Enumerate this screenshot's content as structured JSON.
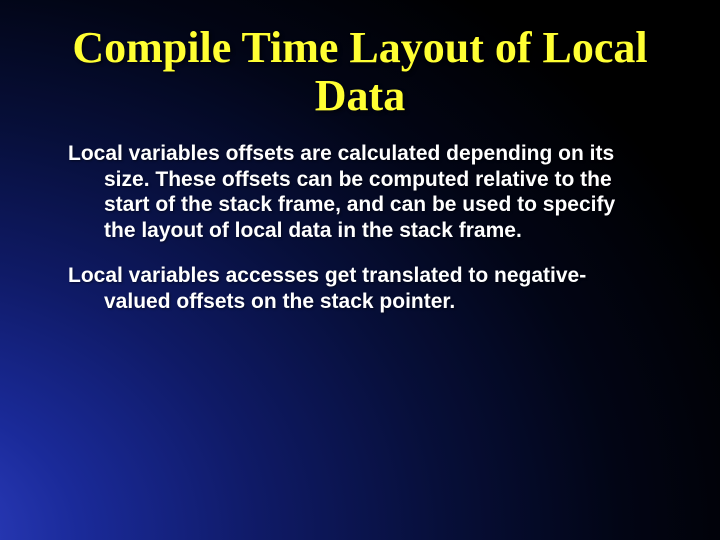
{
  "slide": {
    "title": "Compile Time Layout of Local Data",
    "paragraphs": [
      "Local variables offsets are calculated depending on its size. These offsets can be computed relative to the start of the stack frame, and can be used to specify the layout of local data in the stack frame.",
      "Local variables accesses get translated to negative-valued offsets on the stack pointer."
    ]
  }
}
